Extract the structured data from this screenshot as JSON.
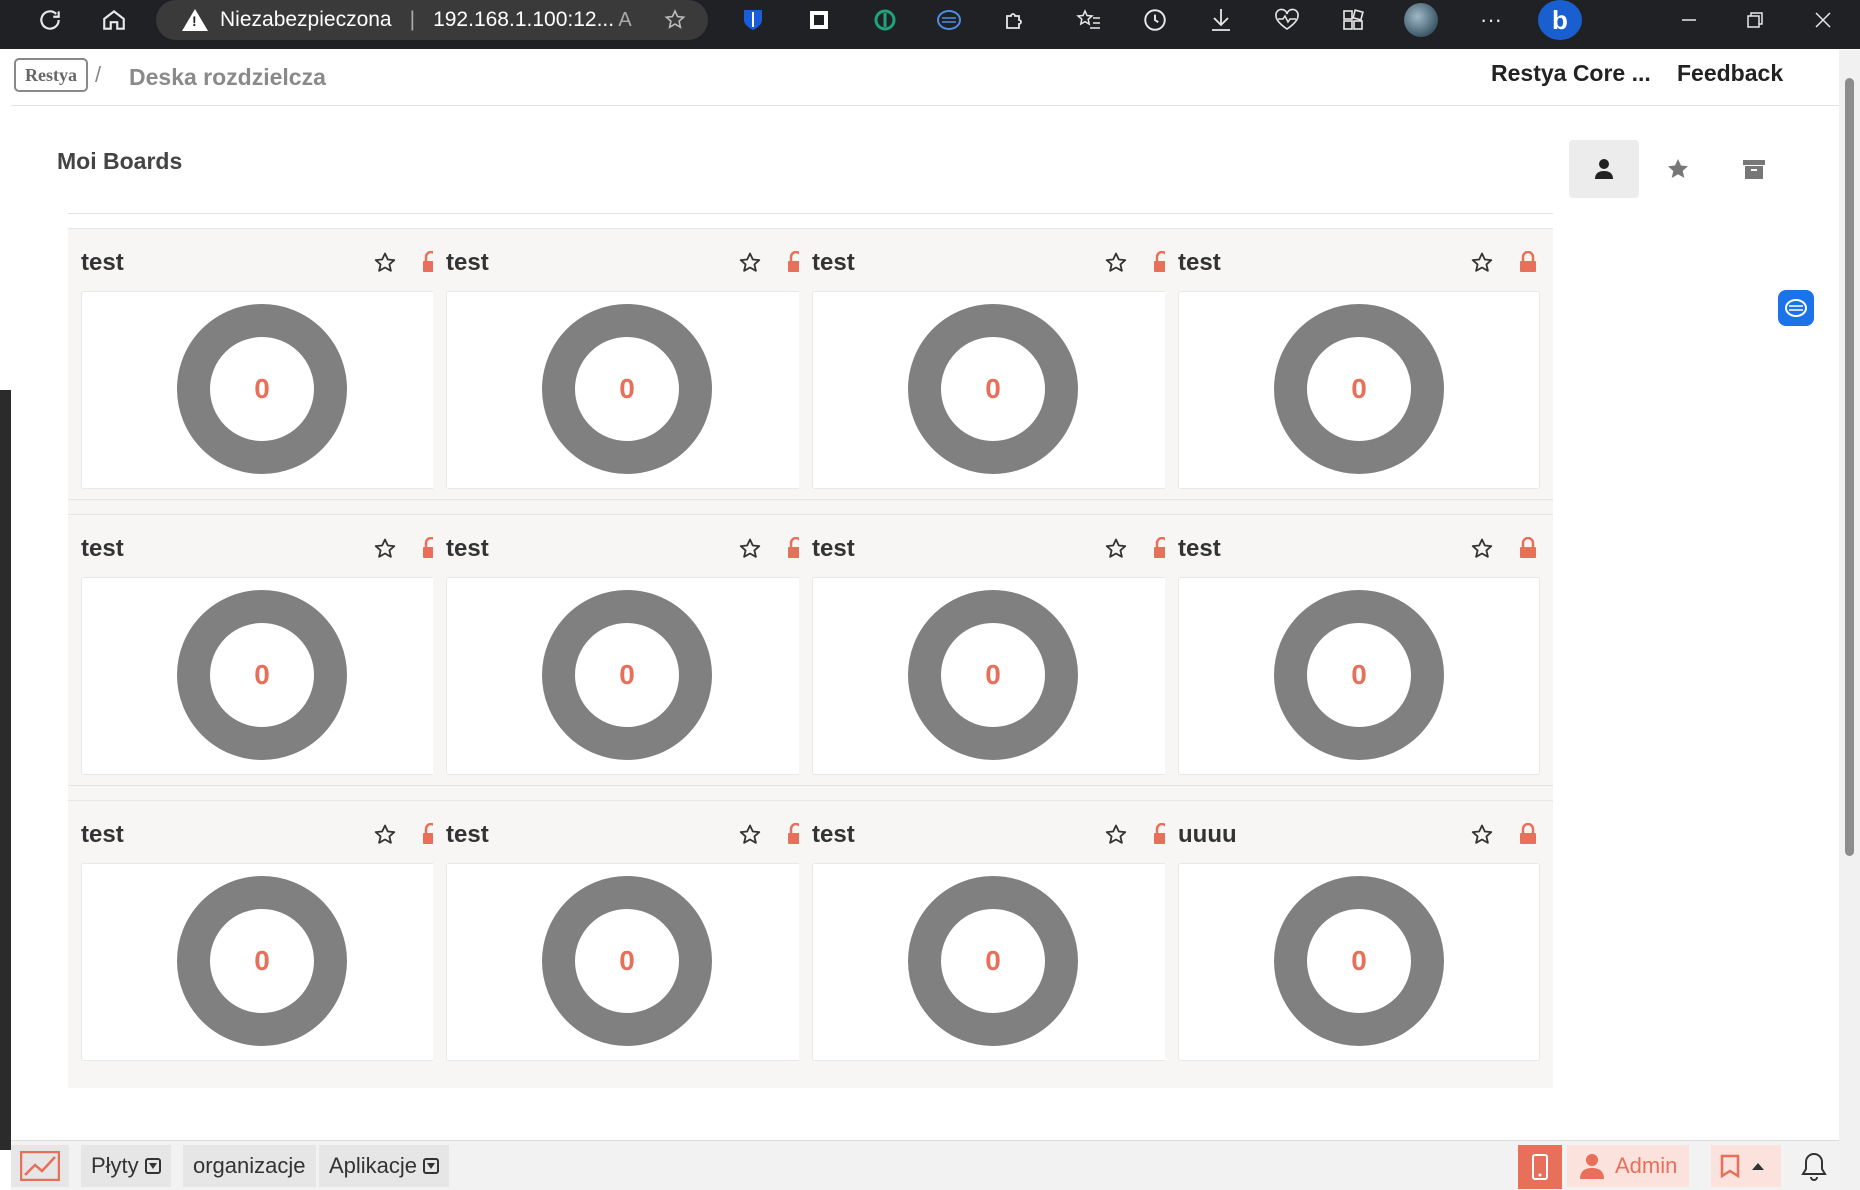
{
  "browser": {
    "security_label": "Niezabezpieczona",
    "url": "192.168.1.100:12...",
    "icons": [
      "refresh-icon",
      "home-icon",
      "read-aloud-icon",
      "add-favorite-icon",
      "bitwarden-icon",
      "extension-icon",
      "extension-icon",
      "brain-icon",
      "puzzle-icon",
      "favorites-icon",
      "history-icon",
      "download-icon",
      "health-icon",
      "collections-icon",
      "profile-icon",
      "more-icon",
      "bing-icon",
      "minimize-icon",
      "restore-icon",
      "close-icon"
    ]
  },
  "header": {
    "logo": "Restya",
    "breadcrumb_sep": "/",
    "breadcrumb": "Deska rozdzielcza",
    "link_core": "Restya Core ...",
    "link_feedback": "Feedback"
  },
  "main": {
    "section_title": "Moi Boards",
    "boards": [
      {
        "title": "test",
        "count": "0"
      },
      {
        "title": "test",
        "count": "0"
      },
      {
        "title": "test",
        "count": "0"
      },
      {
        "title": "test",
        "count": "0"
      },
      {
        "title": "test",
        "count": "0"
      },
      {
        "title": "test",
        "count": "0"
      },
      {
        "title": "test",
        "count": "0"
      },
      {
        "title": "test",
        "count": "0"
      },
      {
        "title": "test",
        "count": "0"
      },
      {
        "title": "test",
        "count": "0"
      },
      {
        "title": "test",
        "count": "0"
      },
      {
        "title": "uuuu",
        "count": "0"
      }
    ]
  },
  "footer": {
    "boards_label": "Płyty",
    "org_label": "organizacje",
    "apps_label": "Aplikacje",
    "admin_label": "Admin"
  },
  "colors": {
    "accent": "#e8705b",
    "donut": "#808080",
    "card_bg": "#f7f6f5"
  }
}
